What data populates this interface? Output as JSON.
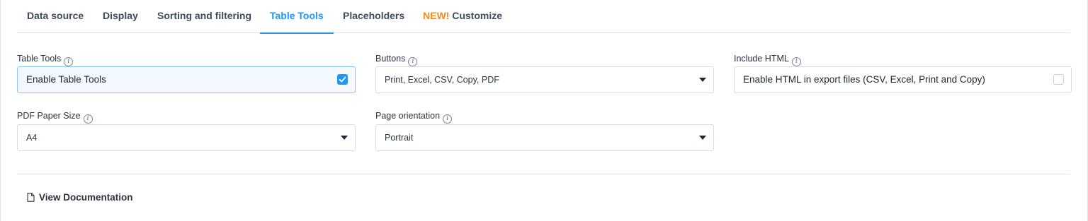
{
  "tabs": [
    {
      "label": "Data source"
    },
    {
      "label": "Display"
    },
    {
      "label": "Sorting and filtering"
    },
    {
      "label": "Table Tools",
      "active": true
    },
    {
      "label": "Placeholders"
    },
    {
      "new_badge": "NEW!",
      "label": "Customize"
    }
  ],
  "info_glyph": "i",
  "fields": {
    "table_tools": {
      "label": "Table Tools",
      "value": "Enable Table Tools",
      "checked": true
    },
    "buttons": {
      "label": "Buttons",
      "value": "Print, Excel, CSV, Copy, PDF"
    },
    "include_html": {
      "label": "Include HTML",
      "value": "Enable HTML in export files (CSV, Excel, Print and Copy)",
      "checked": false
    },
    "pdf_paper_size": {
      "label": "PDF Paper Size",
      "value": "A4"
    },
    "page_orientation": {
      "label": "Page orientation",
      "value": "Portrait"
    }
  },
  "footer": {
    "doc_link": "View Documentation"
  },
  "colors": {
    "accent": "#2196f3",
    "new_badge": "#ef8c22"
  },
  "icons": {
    "info": "info-icon",
    "document": "document-icon",
    "check": "checkmark-icon",
    "caret": "caret-down-icon"
  }
}
